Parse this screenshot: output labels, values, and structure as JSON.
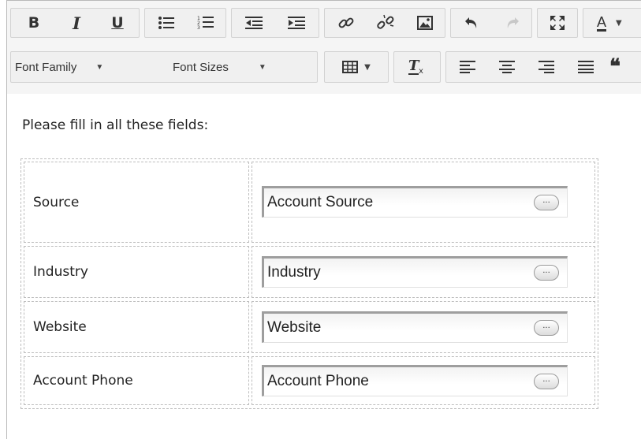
{
  "toolbar": {
    "font_family_label": "Font Family",
    "font_sizes_label": "Font Sizes",
    "bold_glyph": "B",
    "italic_glyph": "I",
    "underline_glyph": "U",
    "text_color_glyph": "A",
    "quote_glyph": "❝"
  },
  "content": {
    "intro_text": "Please fill in all these fields:",
    "fields": [
      {
        "label": "Source",
        "value": "Account Source",
        "button": "..."
      },
      {
        "label": "Industry",
        "value": "Industry",
        "button": "..."
      },
      {
        "label": "Website",
        "value": "Website",
        "button": "..."
      },
      {
        "label": "Account Phone",
        "value": "Account Phone",
        "button": "..."
      }
    ]
  },
  "icons": [
    "bold-icon",
    "italic-icon",
    "underline-icon",
    "bullet-list-icon",
    "numbered-list-icon",
    "outdent-icon",
    "indent-icon",
    "link-icon",
    "unlink-icon",
    "image-icon",
    "undo-icon",
    "redo-icon",
    "fullscreen-icon",
    "text-color-icon",
    "table-icon",
    "clear-formatting-icon",
    "align-left-icon",
    "align-center-icon",
    "align-right-icon",
    "justify-icon",
    "blockquote-icon"
  ]
}
